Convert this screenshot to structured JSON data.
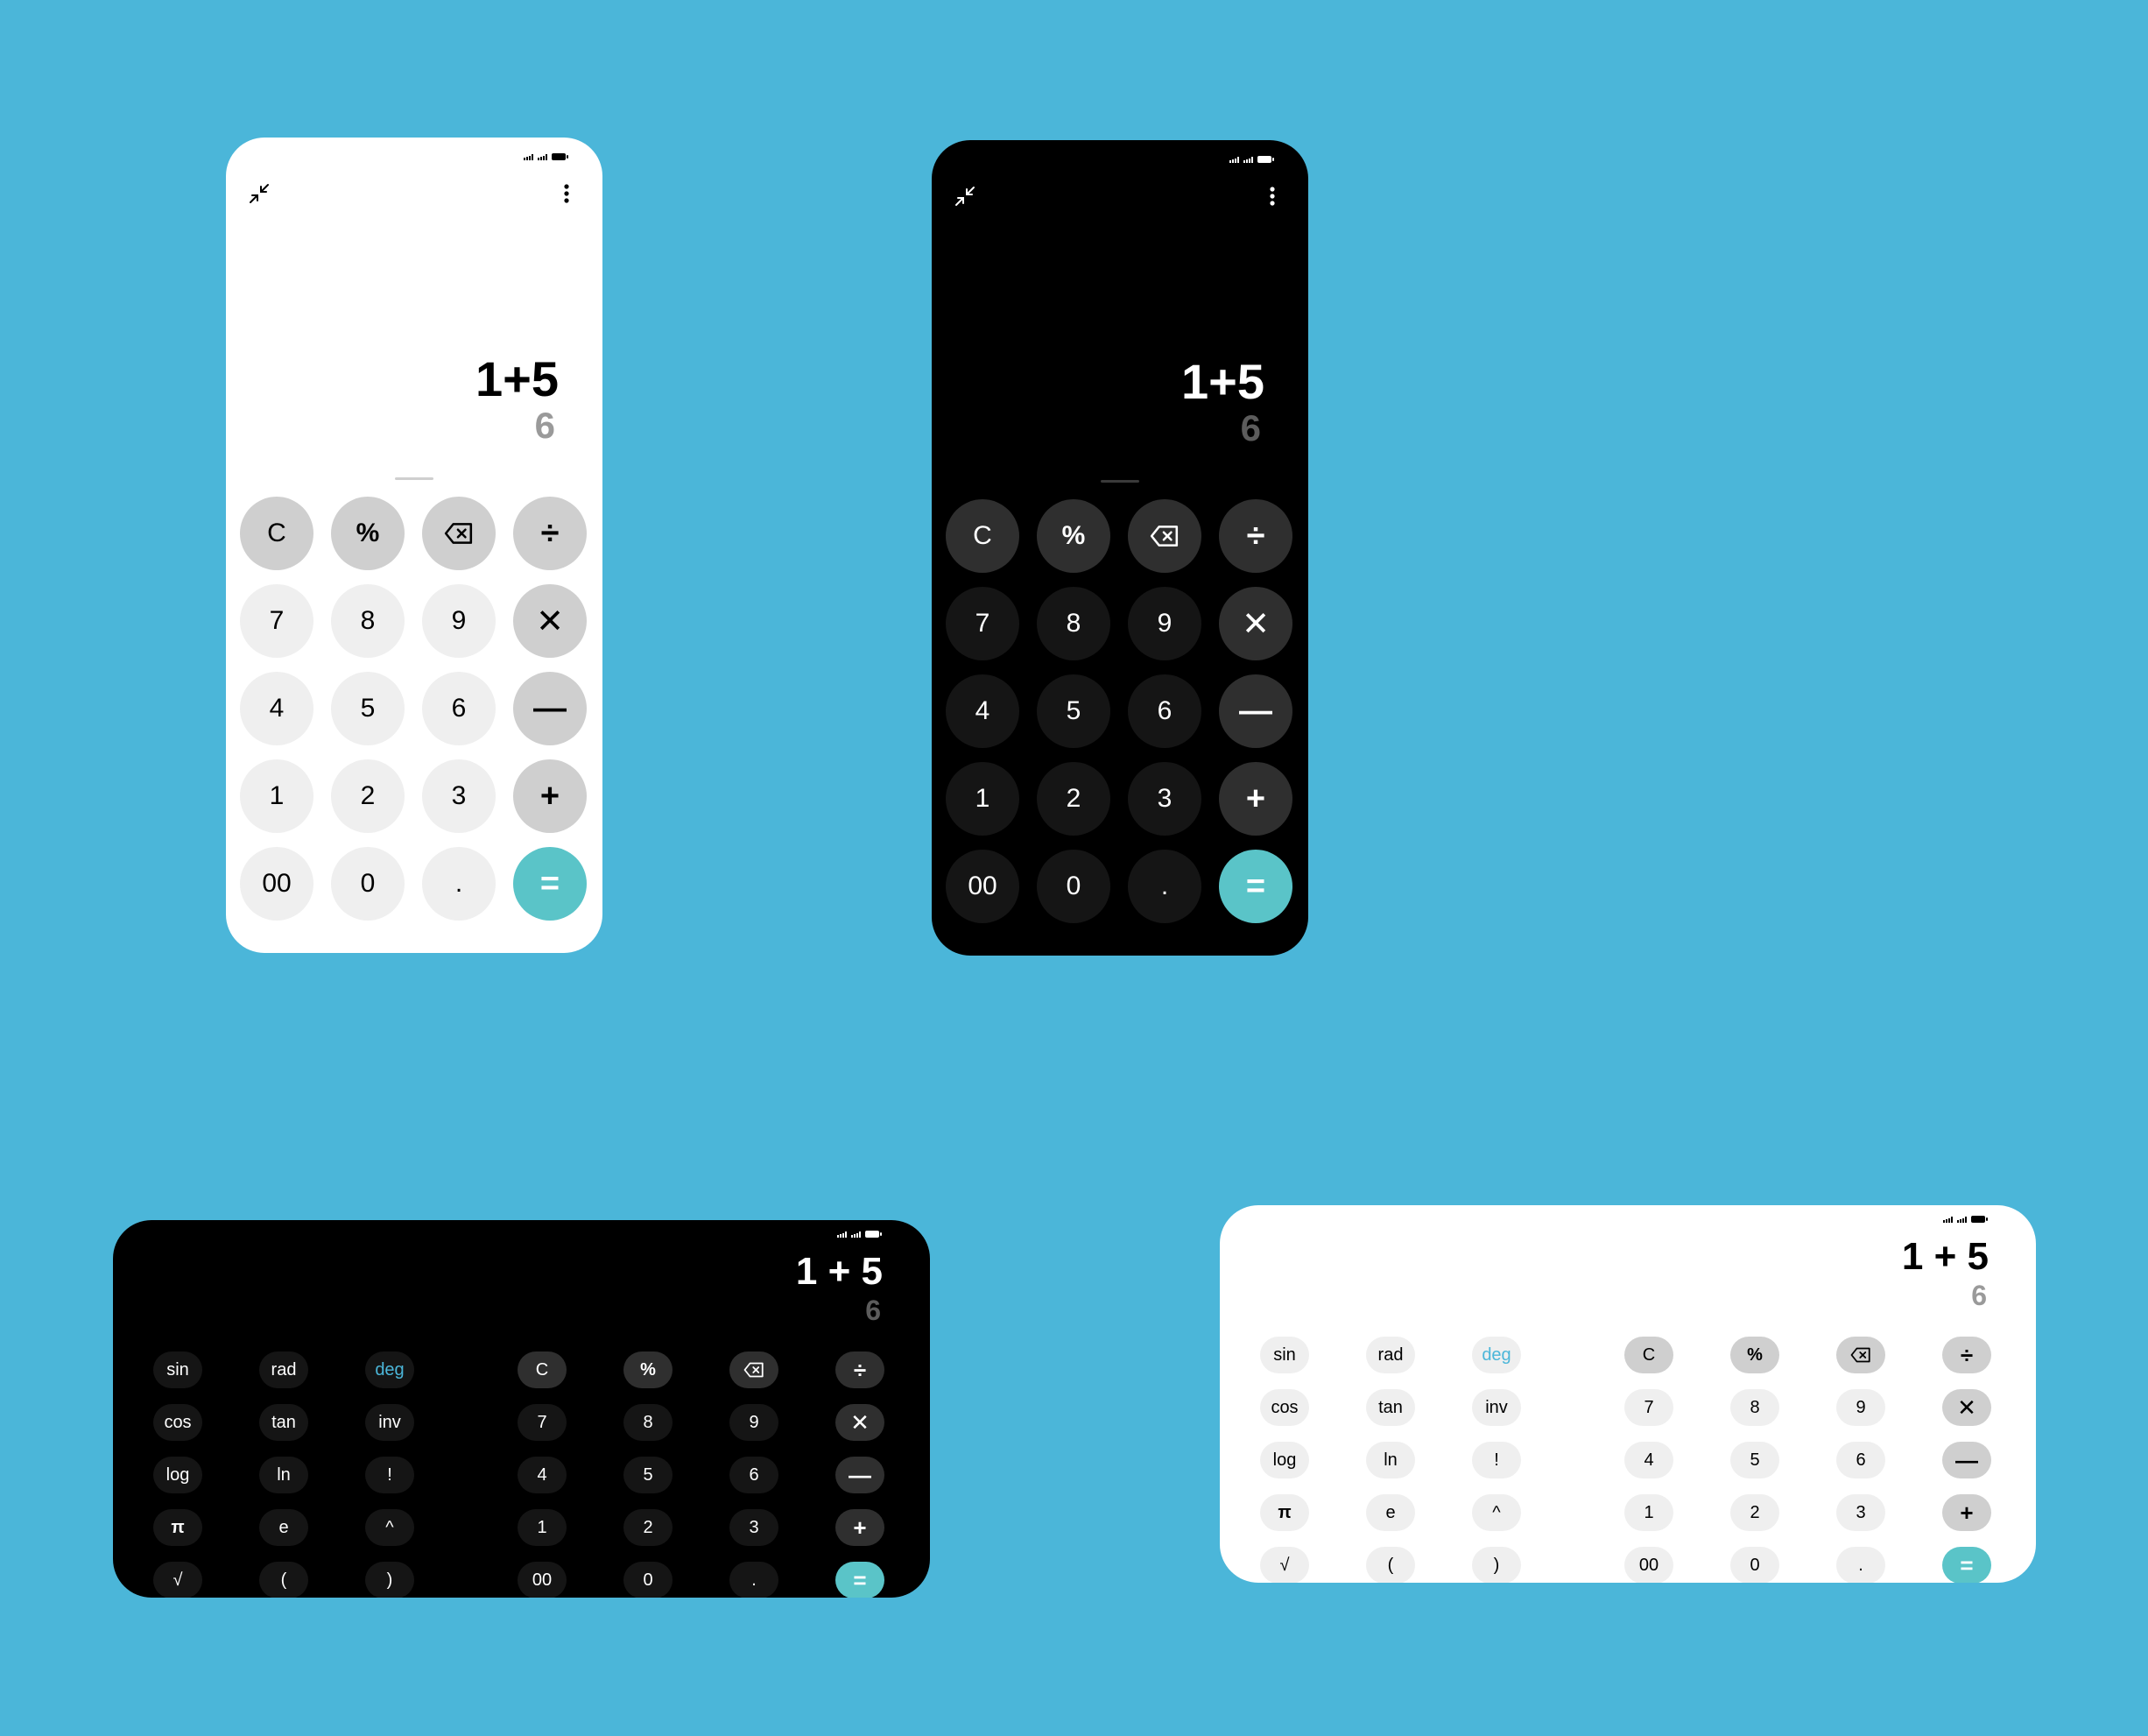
{
  "colors": {
    "background": "#4bb6d9",
    "equals_key": "#5ac4c8",
    "light_surface": "#ffffff",
    "dark_surface": "#000000",
    "accent_text": "#4bb6d9"
  },
  "portrait_light": {
    "expression": "1+5",
    "result": "6",
    "icons": [
      "collapse-icon",
      "more-vert-icon"
    ],
    "keys": [
      {
        "label": "C",
        "kind": "fn"
      },
      {
        "label": "%",
        "kind": "fn"
      },
      {
        "label": "",
        "icon": "backspace",
        "kind": "fn"
      },
      {
        "label": "÷",
        "kind": "op"
      },
      {
        "label": "7",
        "kind": "num"
      },
      {
        "label": "8",
        "kind": "num"
      },
      {
        "label": "9",
        "kind": "num"
      },
      {
        "label": "✕",
        "kind": "op"
      },
      {
        "label": "4",
        "kind": "num"
      },
      {
        "label": "5",
        "kind": "num"
      },
      {
        "label": "6",
        "kind": "num"
      },
      {
        "label": "—",
        "kind": "op"
      },
      {
        "label": "1",
        "kind": "num"
      },
      {
        "label": "2",
        "kind": "num"
      },
      {
        "label": "3",
        "kind": "num"
      },
      {
        "label": "+",
        "kind": "op"
      },
      {
        "label": "00",
        "kind": "num"
      },
      {
        "label": "0",
        "kind": "num"
      },
      {
        "label": ".",
        "kind": "num"
      },
      {
        "label": "=",
        "kind": "eq"
      }
    ]
  },
  "portrait_dark": {
    "expression": "1+5",
    "result": "6",
    "icons": [
      "collapse-icon",
      "more-vert-icon"
    ],
    "keys": [
      {
        "label": "C",
        "kind": "fn"
      },
      {
        "label": "%",
        "kind": "fn"
      },
      {
        "label": "",
        "icon": "backspace",
        "kind": "fn"
      },
      {
        "label": "÷",
        "kind": "op"
      },
      {
        "label": "7",
        "kind": "num"
      },
      {
        "label": "8",
        "kind": "num"
      },
      {
        "label": "9",
        "kind": "num"
      },
      {
        "label": "✕",
        "kind": "op"
      },
      {
        "label": "4",
        "kind": "num"
      },
      {
        "label": "5",
        "kind": "num"
      },
      {
        "label": "6",
        "kind": "num"
      },
      {
        "label": "—",
        "kind": "op"
      },
      {
        "label": "1",
        "kind": "num"
      },
      {
        "label": "2",
        "kind": "num"
      },
      {
        "label": "3",
        "kind": "num"
      },
      {
        "label": "+",
        "kind": "op"
      },
      {
        "label": "00",
        "kind": "num"
      },
      {
        "label": "0",
        "kind": "num"
      },
      {
        "label": ".",
        "kind": "num"
      },
      {
        "label": "=",
        "kind": "eq"
      }
    ]
  },
  "landscape_dark": {
    "expression": "1 + 5",
    "result": "6",
    "sci_keys": [
      {
        "label": "sin"
      },
      {
        "label": "rad"
      },
      {
        "label": "deg",
        "accent": true
      },
      {
        "label": "cos"
      },
      {
        "label": "tan"
      },
      {
        "label": "inv"
      },
      {
        "label": "log"
      },
      {
        "label": "ln"
      },
      {
        "label": "!"
      },
      {
        "label": "π"
      },
      {
        "label": "e"
      },
      {
        "label": "^"
      },
      {
        "label": "√"
      },
      {
        "label": "("
      },
      {
        "label": ")"
      }
    ],
    "keys": [
      {
        "label": "C",
        "kind": "fn"
      },
      {
        "label": "%",
        "kind": "fn"
      },
      {
        "label": "",
        "icon": "backspace",
        "kind": "fn"
      },
      {
        "label": "÷",
        "kind": "op"
      },
      {
        "label": "7",
        "kind": "num"
      },
      {
        "label": "8",
        "kind": "num"
      },
      {
        "label": "9",
        "kind": "num"
      },
      {
        "label": "✕",
        "kind": "op"
      },
      {
        "label": "4",
        "kind": "num"
      },
      {
        "label": "5",
        "kind": "num"
      },
      {
        "label": "6",
        "kind": "num"
      },
      {
        "label": "—",
        "kind": "op"
      },
      {
        "label": "1",
        "kind": "num"
      },
      {
        "label": "2",
        "kind": "num"
      },
      {
        "label": "3",
        "kind": "num"
      },
      {
        "label": "+",
        "kind": "op"
      },
      {
        "label": "00",
        "kind": "num"
      },
      {
        "label": "0",
        "kind": "num"
      },
      {
        "label": ".",
        "kind": "num"
      },
      {
        "label": "=",
        "kind": "eq"
      }
    ]
  },
  "landscape_light": {
    "expression": "1 + 5",
    "result": "6",
    "sci_keys": [
      {
        "label": "sin"
      },
      {
        "label": "rad"
      },
      {
        "label": "deg",
        "accent": true
      },
      {
        "label": "cos"
      },
      {
        "label": "tan"
      },
      {
        "label": "inv"
      },
      {
        "label": "log"
      },
      {
        "label": "ln"
      },
      {
        "label": "!"
      },
      {
        "label": "π"
      },
      {
        "label": "e"
      },
      {
        "label": "^"
      },
      {
        "label": "√"
      },
      {
        "label": "("
      },
      {
        "label": ")"
      }
    ],
    "keys": [
      {
        "label": "C",
        "kind": "fn"
      },
      {
        "label": "%",
        "kind": "fn"
      },
      {
        "label": "",
        "icon": "backspace",
        "kind": "fn"
      },
      {
        "label": "÷",
        "kind": "op"
      },
      {
        "label": "7",
        "kind": "num"
      },
      {
        "label": "8",
        "kind": "num"
      },
      {
        "label": "9",
        "kind": "num"
      },
      {
        "label": "✕",
        "kind": "op"
      },
      {
        "label": "4",
        "kind": "num"
      },
      {
        "label": "5",
        "kind": "num"
      },
      {
        "label": "6",
        "kind": "num"
      },
      {
        "label": "—",
        "kind": "op"
      },
      {
        "label": "1",
        "kind": "num"
      },
      {
        "label": "2",
        "kind": "num"
      },
      {
        "label": "3",
        "kind": "num"
      },
      {
        "label": "+",
        "kind": "op"
      },
      {
        "label": "00",
        "kind": "num"
      },
      {
        "label": "0",
        "kind": "num"
      },
      {
        "label": ".",
        "kind": "num"
      },
      {
        "label": "=",
        "kind": "eq"
      }
    ]
  }
}
